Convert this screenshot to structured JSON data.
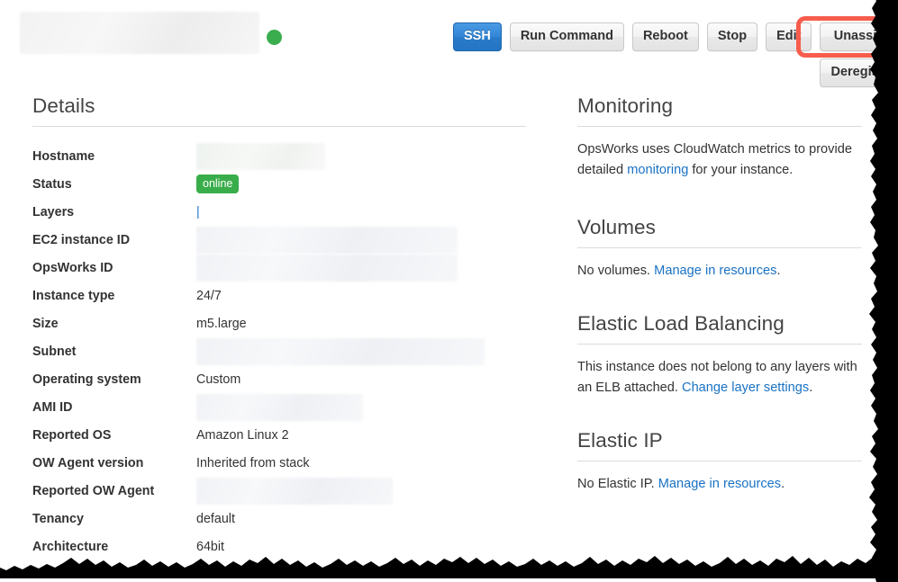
{
  "header": {
    "instance_name_redacted": true,
    "status_indicator": "online-green-dot",
    "buttons": [
      {
        "label": "SSH",
        "style": "primary"
      },
      {
        "label": "Run Command",
        "style": "default"
      },
      {
        "label": "Reboot",
        "style": "default"
      },
      {
        "label": "Stop",
        "style": "default"
      },
      {
        "label": "Edit",
        "style": "default"
      },
      {
        "label": "Unassign",
        "style": "default",
        "highlighted": true
      },
      {
        "label": "Deregister",
        "style": "default"
      }
    ]
  },
  "annotation": {
    "target_label": "Unassign",
    "color": "#f75c4c"
  },
  "details": {
    "heading": "Details",
    "rows": [
      {
        "key": "Hostname",
        "value": "",
        "redacted": true
      },
      {
        "key": "Status",
        "value": "online",
        "type": "badge"
      },
      {
        "key": "Layers",
        "value": "|",
        "type": "link"
      },
      {
        "key": "EC2 instance ID",
        "value": "",
        "redacted": true
      },
      {
        "key": "OpsWorks ID",
        "value": "",
        "redacted": true
      },
      {
        "key": "Instance type",
        "value": "24/7"
      },
      {
        "key": "Size",
        "value": "m5.large"
      },
      {
        "key": "Subnet",
        "value": "",
        "redacted": true
      },
      {
        "key": "Operating system",
        "value": "Custom"
      },
      {
        "key": "AMI ID",
        "value": "",
        "redacted": true
      },
      {
        "key": "Reported OS",
        "value": "Amazon Linux 2"
      },
      {
        "key": "OW Agent version",
        "value": "Inherited from stack"
      },
      {
        "key": "Reported OW Agent",
        "value": "",
        "redacted": true
      },
      {
        "key": "Tenancy",
        "value": "default"
      },
      {
        "key": "Architecture",
        "value": "64bit"
      }
    ]
  },
  "monitoring": {
    "heading": "Monitoring",
    "text_before": "OpsWorks uses CloudWatch metrics to provide detailed ",
    "link": "monitoring",
    "text_after": " for your instance."
  },
  "volumes": {
    "heading": "Volumes",
    "text_before": "No volumes. ",
    "link": "Manage in resources",
    "text_after": "."
  },
  "elb": {
    "heading": "Elastic Load Balancing",
    "text_before": "This instance does not belong to any layers with an ELB attached. ",
    "link": "Change layer settings",
    "text_after": "."
  },
  "elastic_ip": {
    "heading": "Elastic IP",
    "text_before": "No Elastic IP. ",
    "link": "Manage in resources",
    "text_after": "."
  },
  "colors": {
    "primary_button": "#2a7ccb",
    "status_badge": "#39ad4a",
    "status_dot": "#3aae4e",
    "link": "#1a72c4",
    "annotation": "#f75c4c",
    "text": "#333333",
    "heading": "#444444",
    "rule": "#dcdcdc"
  }
}
